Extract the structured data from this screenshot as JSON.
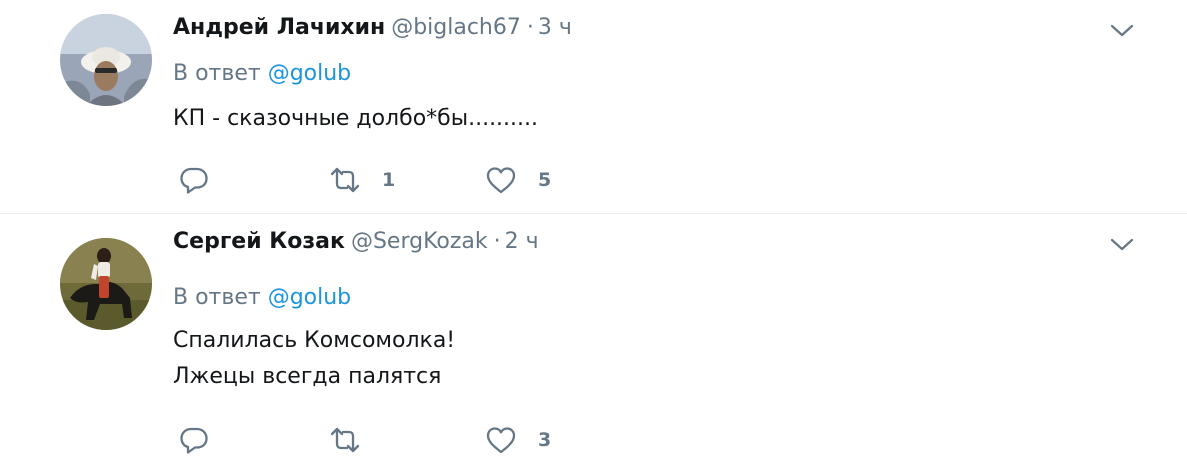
{
  "tweets": [
    {
      "author_name": "Андрей Лачихин",
      "author_handle": "@biglach67",
      "separator": "·",
      "time": "3 ч",
      "reply_prefix": "В ответ",
      "reply_to": "@golub",
      "text_lines": [
        "КП - сказочные долбо*бы.........."
      ],
      "retweets": "1",
      "likes": "5"
    },
    {
      "author_name": "Сергей Козак",
      "author_handle": "@SergKozak",
      "separator": "·",
      "time": "2 ч",
      "reply_prefix": "В ответ",
      "reply_to": "@golub",
      "text_lines": [
        "Спалилась Комсомолка!",
        "Лжецы всегда палятся"
      ],
      "retweets": "",
      "likes": "3"
    }
  ],
  "icons": {
    "reply": "reply-icon",
    "retweet": "retweet-icon",
    "like": "like-icon",
    "caret": "chevron-down-icon"
  },
  "colors": {
    "text": "#14171a",
    "secondary": "#657786",
    "link": "#1b95e0",
    "divider": "#e6ecf0"
  }
}
